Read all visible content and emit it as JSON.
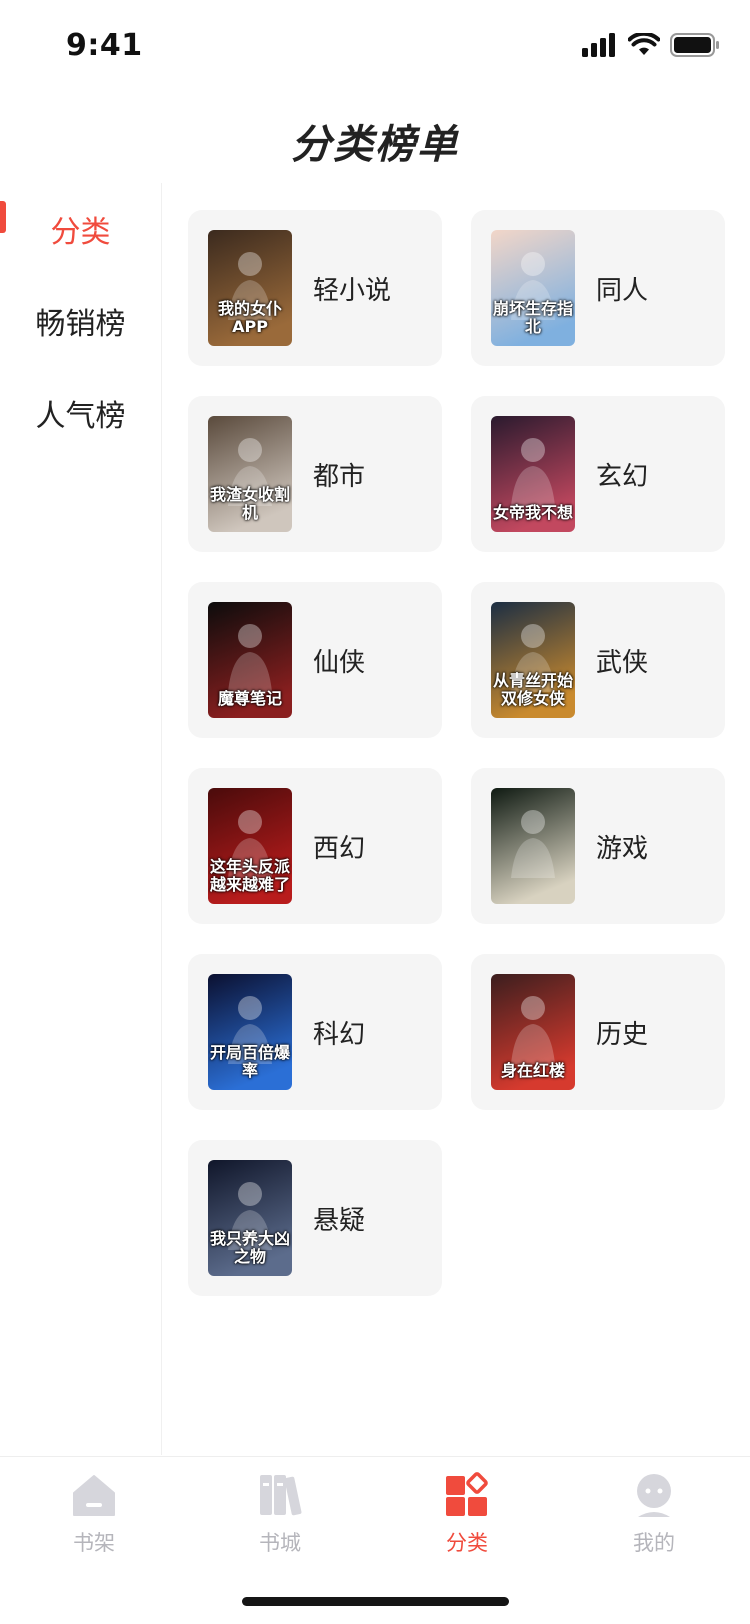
{
  "status_bar": {
    "time": "9:41",
    "icons": [
      "signal-icon",
      "wifi-icon",
      "battery-icon"
    ]
  },
  "header": {
    "title": "分类榜单"
  },
  "sidebar": {
    "items": [
      {
        "label": "分类",
        "active": true
      },
      {
        "label": "畅销榜",
        "active": false
      },
      {
        "label": "人气榜",
        "active": false
      }
    ]
  },
  "categories": [
    {
      "label": "轻小说",
      "cover_text": "我的女仆APP",
      "colors": [
        "#3b2a1e",
        "#9a6a3a"
      ]
    },
    {
      "label": "同人",
      "cover_text": "崩坏生存指北",
      "colors": [
        "#f2d6c8",
        "#7fb0df"
      ]
    },
    {
      "label": "都市",
      "cover_text": "我渣女收割机",
      "colors": [
        "#5a4a3c",
        "#cfc6bd"
      ]
    },
    {
      "label": "玄幻",
      "cover_text": "女帝我不想",
      "colors": [
        "#2a1a2e",
        "#c2485f"
      ]
    },
    {
      "label": "仙侠",
      "cover_text": "魔尊笔记",
      "colors": [
        "#0c0c0c",
        "#8a1f1f"
      ]
    },
    {
      "label": "武侠",
      "cover_text": "从青丝开始双修女侠",
      "colors": [
        "#1c2e43",
        "#c98a2e"
      ]
    },
    {
      "label": "西幻",
      "cover_text": "这年头反派越来越难了",
      "colors": [
        "#4a0b0b",
        "#b81c1c"
      ]
    },
    {
      "label": "游戏",
      "cover_text": "",
      "colors": [
        "#0f1a12",
        "#d8d2c0"
      ]
    },
    {
      "label": "科幻",
      "cover_text": "开局百倍爆率",
      "colors": [
        "#0b1030",
        "#2b6fd6"
      ]
    },
    {
      "label": "历史",
      "cover_text": "身在红楼",
      "colors": [
        "#3b1e1e",
        "#d63a2e"
      ]
    },
    {
      "label": "悬疑",
      "cover_text": "我只养大凶之物",
      "colors": [
        "#10162a",
        "#5c6c8c"
      ]
    }
  ],
  "tab_bar": {
    "tabs": [
      {
        "label": "书架",
        "icon": "bookshelf-icon",
        "active": false
      },
      {
        "label": "书城",
        "icon": "bookstore-icon",
        "active": false
      },
      {
        "label": "分类",
        "icon": "category-icon",
        "active": true
      },
      {
        "label": "我的",
        "icon": "profile-icon",
        "active": false
      }
    ]
  },
  "colors": {
    "accent": "#f04b3d",
    "inactive": "#b5b5bb",
    "card_bg": "#f5f5f5"
  }
}
